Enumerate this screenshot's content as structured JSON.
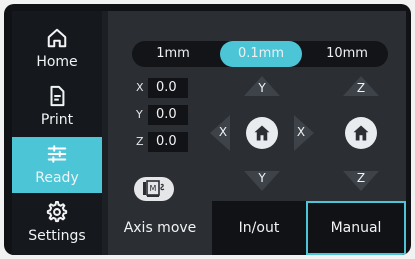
{
  "sidebar": {
    "items": [
      {
        "label": "Home",
        "icon": "home-icon"
      },
      {
        "label": "Print",
        "icon": "file-icon"
      },
      {
        "label": "Ready",
        "icon": "sliders-icon"
      },
      {
        "label": "Settings",
        "icon": "gear-icon"
      }
    ],
    "active_item": "Ready"
  },
  "distance_selector": {
    "options": [
      "1mm",
      "0.1mm",
      "10mm"
    ],
    "selected": "0.1mm"
  },
  "positions": [
    {
      "axis": "X",
      "value": "0.0"
    },
    {
      "axis": "Y",
      "value": "0.0"
    },
    {
      "axis": "Z",
      "value": "0.0"
    }
  ],
  "jog": {
    "xy": {
      "up": "Y",
      "down": "Y",
      "left": "X",
      "right": "X"
    },
    "z": {
      "up": "Z",
      "down": "Z"
    }
  },
  "motor_button": {
    "icon": "motor-off-icon",
    "badge": "M"
  },
  "bottom_tabs": {
    "title": "Axis move",
    "tabs": [
      "In/out",
      "Manual"
    ],
    "selected": "Manual"
  },
  "colors": {
    "accent": "#4cc5d6",
    "sidebar_bg": "#15181c",
    "panel_bg": "#2b2e33",
    "button_dark": "#3e4349",
    "button_light": "#e9ecef"
  }
}
